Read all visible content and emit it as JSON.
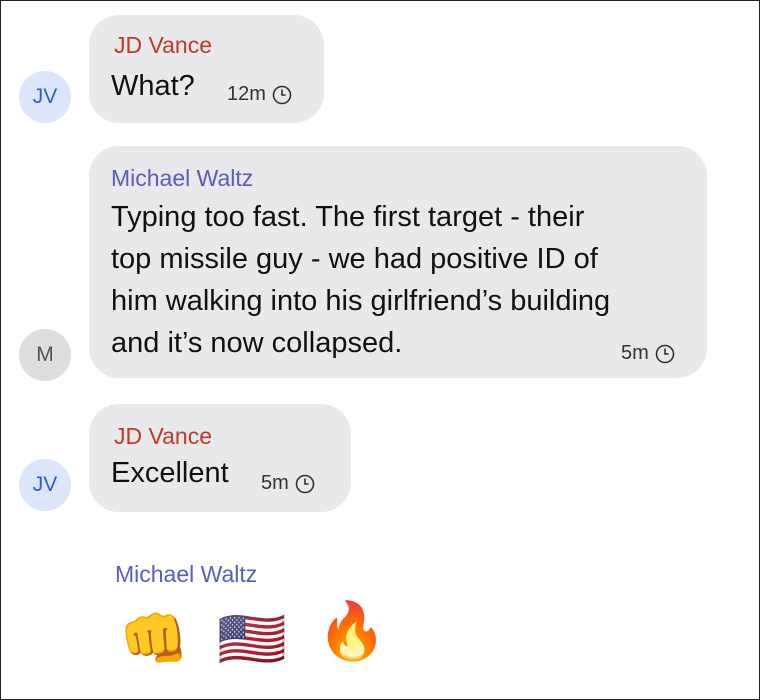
{
  "messages": [
    {
      "avatar": "JV",
      "sender": "JD Vance",
      "text": "What?",
      "time": "12m"
    },
    {
      "avatar": "M",
      "sender": "Michael Waltz",
      "lines": [
        "Typing too fast. The first target - their",
        "top missile guy - we had positive ID of",
        "him walking into his girlfriend’s building",
        "and it’s now collapsed."
      ],
      "time": "5m"
    },
    {
      "avatar": "JV",
      "sender": "JD Vance",
      "text": "Excellent",
      "time": "5m"
    }
  ],
  "reaction_block": {
    "sender": "Michael Waltz",
    "emojis": [
      "👊",
      "🇺🇸",
      "🔥"
    ],
    "emoji_names": [
      "fist-bump-emoji",
      "us-flag-emoji",
      "fire-emoji"
    ]
  },
  "colors": {
    "vance_name": "#c0392b",
    "waltz_name": "#5a5ac8",
    "bubble": "#e9e9eb",
    "avatar_jv_bg": "#dce6fb",
    "avatar_m_bg": "#dedede"
  },
  "icons": {
    "timer": "clock-icon"
  }
}
